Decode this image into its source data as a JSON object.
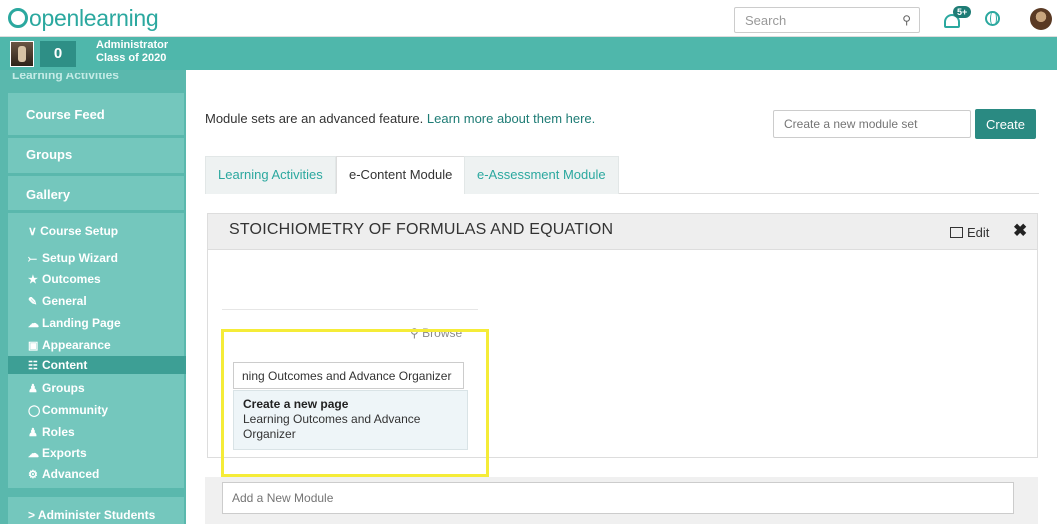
{
  "brand": {
    "logo_text": "openlearning"
  },
  "topbar": {
    "search_placeholder": "Search",
    "notification_count": "5+"
  },
  "user": {
    "points": "0",
    "name": "Administrator",
    "class": "Class of 2020"
  },
  "sidebar": {
    "cut_label": "Learning Activities",
    "items": {
      "course_feed": "Course Feed",
      "groups": "Groups",
      "gallery": "Gallery",
      "course_setup": "Course Setup",
      "administer_students": "Administer Students"
    },
    "setup_items": [
      {
        "label": "Setup Wizard",
        "icon": "magic-wand-icon"
      },
      {
        "label": "Outcomes",
        "icon": "star-icon"
      },
      {
        "label": "General",
        "icon": "edit-icon"
      },
      {
        "label": "Landing Page",
        "icon": "cloud-icon"
      },
      {
        "label": "Appearance",
        "icon": "image-icon"
      },
      {
        "label": "Content",
        "icon": "sitemap-icon"
      },
      {
        "label": "Groups",
        "icon": "users-icon"
      },
      {
        "label": "Community",
        "icon": "community-icon"
      },
      {
        "label": "Roles",
        "icon": "user-icon"
      },
      {
        "label": "Exports",
        "icon": "cloud-download-icon"
      },
      {
        "label": "Advanced",
        "icon": "cogs-icon"
      }
    ],
    "active_item": "Content"
  },
  "main": {
    "notice_text": "Module sets are an advanced feature.",
    "notice_link": "Learn more about them here.",
    "new_module_set_placeholder": "Create a new module set",
    "create_button": "Create",
    "tabs": [
      {
        "label": "Learning Activities",
        "active": false
      },
      {
        "label": "e-Content Module",
        "active": true
      },
      {
        "label": "e-Assessment Module",
        "active": false
      }
    ],
    "module": {
      "title": "STOICHIOMETRY OF FORMULAS AND EQUATION",
      "edit_label": "Edit",
      "close_symbol": "✖",
      "browse_label": "Browse",
      "page_input_value": "ning Outcomes and Advance Organizer",
      "suggestion_title": "Create a new page",
      "suggestion_body": "Learning Outcomes and Advance Organizer"
    },
    "add_module_placeholder": "Add a New Module"
  },
  "colors": {
    "accent": "#2ba89f",
    "sidebar": "#5ab8ad",
    "highlight": "#f5ec38",
    "create_button": "#2a8a82"
  }
}
